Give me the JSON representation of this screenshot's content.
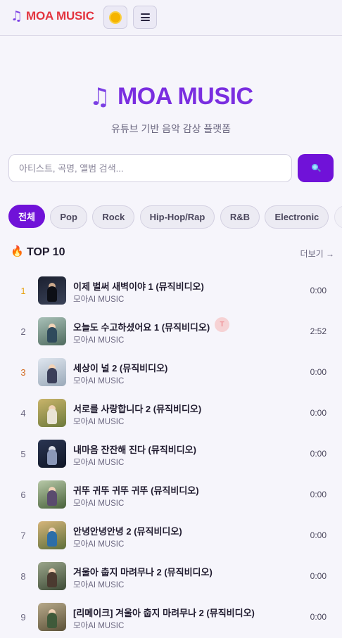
{
  "header": {
    "brand_icon": "music-note-icon",
    "brand": "MOA MUSIC",
    "theme_icon": "sun-icon",
    "menu_icon": "hamburger-icon"
  },
  "hero": {
    "title": "MOA MUSIC",
    "tagline": "유튜브 기반 음악 감상 플랫폼"
  },
  "search": {
    "placeholder": "아티스트, 곡명, 앨범 검색...",
    "value": "",
    "button_icon": "search-icon"
  },
  "genres": {
    "selected": "전체",
    "items": [
      "전체",
      "Pop",
      "Rock",
      "Hip-Hop/Rap",
      "R&B",
      "Electronic",
      "J"
    ]
  },
  "top10": {
    "title": "TOP 10",
    "icon": "fire-icon",
    "more_label": "더보기 →",
    "tracks": [
      {
        "rank": "1",
        "title": "이제 벌써 새벽이야 1 (뮤직비디오)",
        "artist": "모아AI MUSIC",
        "duration": "0:00"
      },
      {
        "rank": "2",
        "title": "오늘도 수고하셨어요 1 (뮤직비디오)",
        "artist": "모아AI MUSIC",
        "duration": "2:52",
        "badge": "T"
      },
      {
        "rank": "3",
        "title": "세상이 널 2 (뮤직비디오)",
        "artist": "모아AI MUSIC",
        "duration": "0:00"
      },
      {
        "rank": "4",
        "title": "서로를 사랑합니다 2 (뮤직비디오)",
        "artist": "모아AI MUSIC",
        "duration": "0:00"
      },
      {
        "rank": "5",
        "title": "내마음 잔잔해 진다 (뮤직비디오)",
        "artist": "모아AI MUSIC",
        "duration": "0:00"
      },
      {
        "rank": "6",
        "title": "귀뚜 귀뚜 귀뚜 귀뚜 (뮤직비디오)",
        "artist": "모아AI MUSIC",
        "duration": "0:00"
      },
      {
        "rank": "7",
        "title": "안녕안녕안녕 2 (뮤직비디오)",
        "artist": "모아AI MUSIC",
        "duration": "0:00"
      },
      {
        "rank": "8",
        "title": "겨울아 춥지 마려무나 2 (뮤직비디오)",
        "artist": "모아AI MUSIC",
        "duration": "0:00"
      },
      {
        "rank": "9",
        "title": "[리메이크] 겨울아 춥지 마려무나 2 (뮤직비디오)",
        "artist": "모아AI MUSIC",
        "duration": "0:00"
      }
    ]
  },
  "colors": {
    "accent": "#7012d8",
    "brand_red": "#e3343f",
    "rank_gold": "#e8a317",
    "rank_bronze": "#d2691e"
  }
}
